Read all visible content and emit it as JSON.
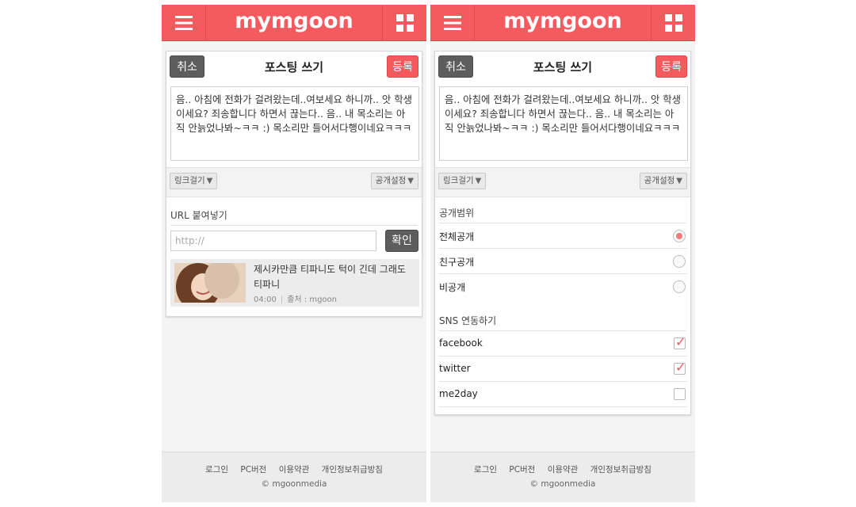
{
  "header": {
    "logo_text": "mymgoon",
    "menu_icon": "hamburger-icon",
    "grid_icon": "grid-icon",
    "brand_color": "#f55a5e"
  },
  "post": {
    "cancel_label": "취소",
    "title": "포스팅 쓰기",
    "register_label": "등록",
    "body_text": "음.. 아침에 전화가 걸려왔는데..여보세요 하니까.. 앗 학생이세요? 죄송합니다 하면서 끊는다.. 음.. 내 목소리는 아직 안늙었나봐~ㅋㅋ :) 목소리만 들어서다행이네요ㅋㅋㅋ",
    "link_button_label": "링크걸기",
    "public_button_label": "공개설정",
    "dropdown_icon": "triangle-down-icon"
  },
  "link_panel": {
    "url_label": "URL 붙여넣기",
    "url_placeholder": "http://",
    "confirm_label": "확인",
    "preview": {
      "title": "제시카만큼 티파니도 턱이 긴데 그래도 티파니",
      "duration": "04:00",
      "source": "출처 : mgoon"
    }
  },
  "public_panel": {
    "scope_label": "공개범위",
    "options": [
      {
        "label": "전체공개",
        "selected": true
      },
      {
        "label": "친구공개",
        "selected": false
      },
      {
        "label": "비공개",
        "selected": false
      }
    ],
    "sns_label": "SNS 연동하기",
    "sns": [
      {
        "label": "facebook",
        "checked": true
      },
      {
        "label": "twitter",
        "checked": true
      },
      {
        "label": "me2day",
        "checked": false
      }
    ]
  },
  "footer": {
    "links": [
      "로그인",
      "PC버전",
      "이용약관",
      "개인정보취급방침"
    ],
    "copyright": "© mgoonmedia"
  }
}
